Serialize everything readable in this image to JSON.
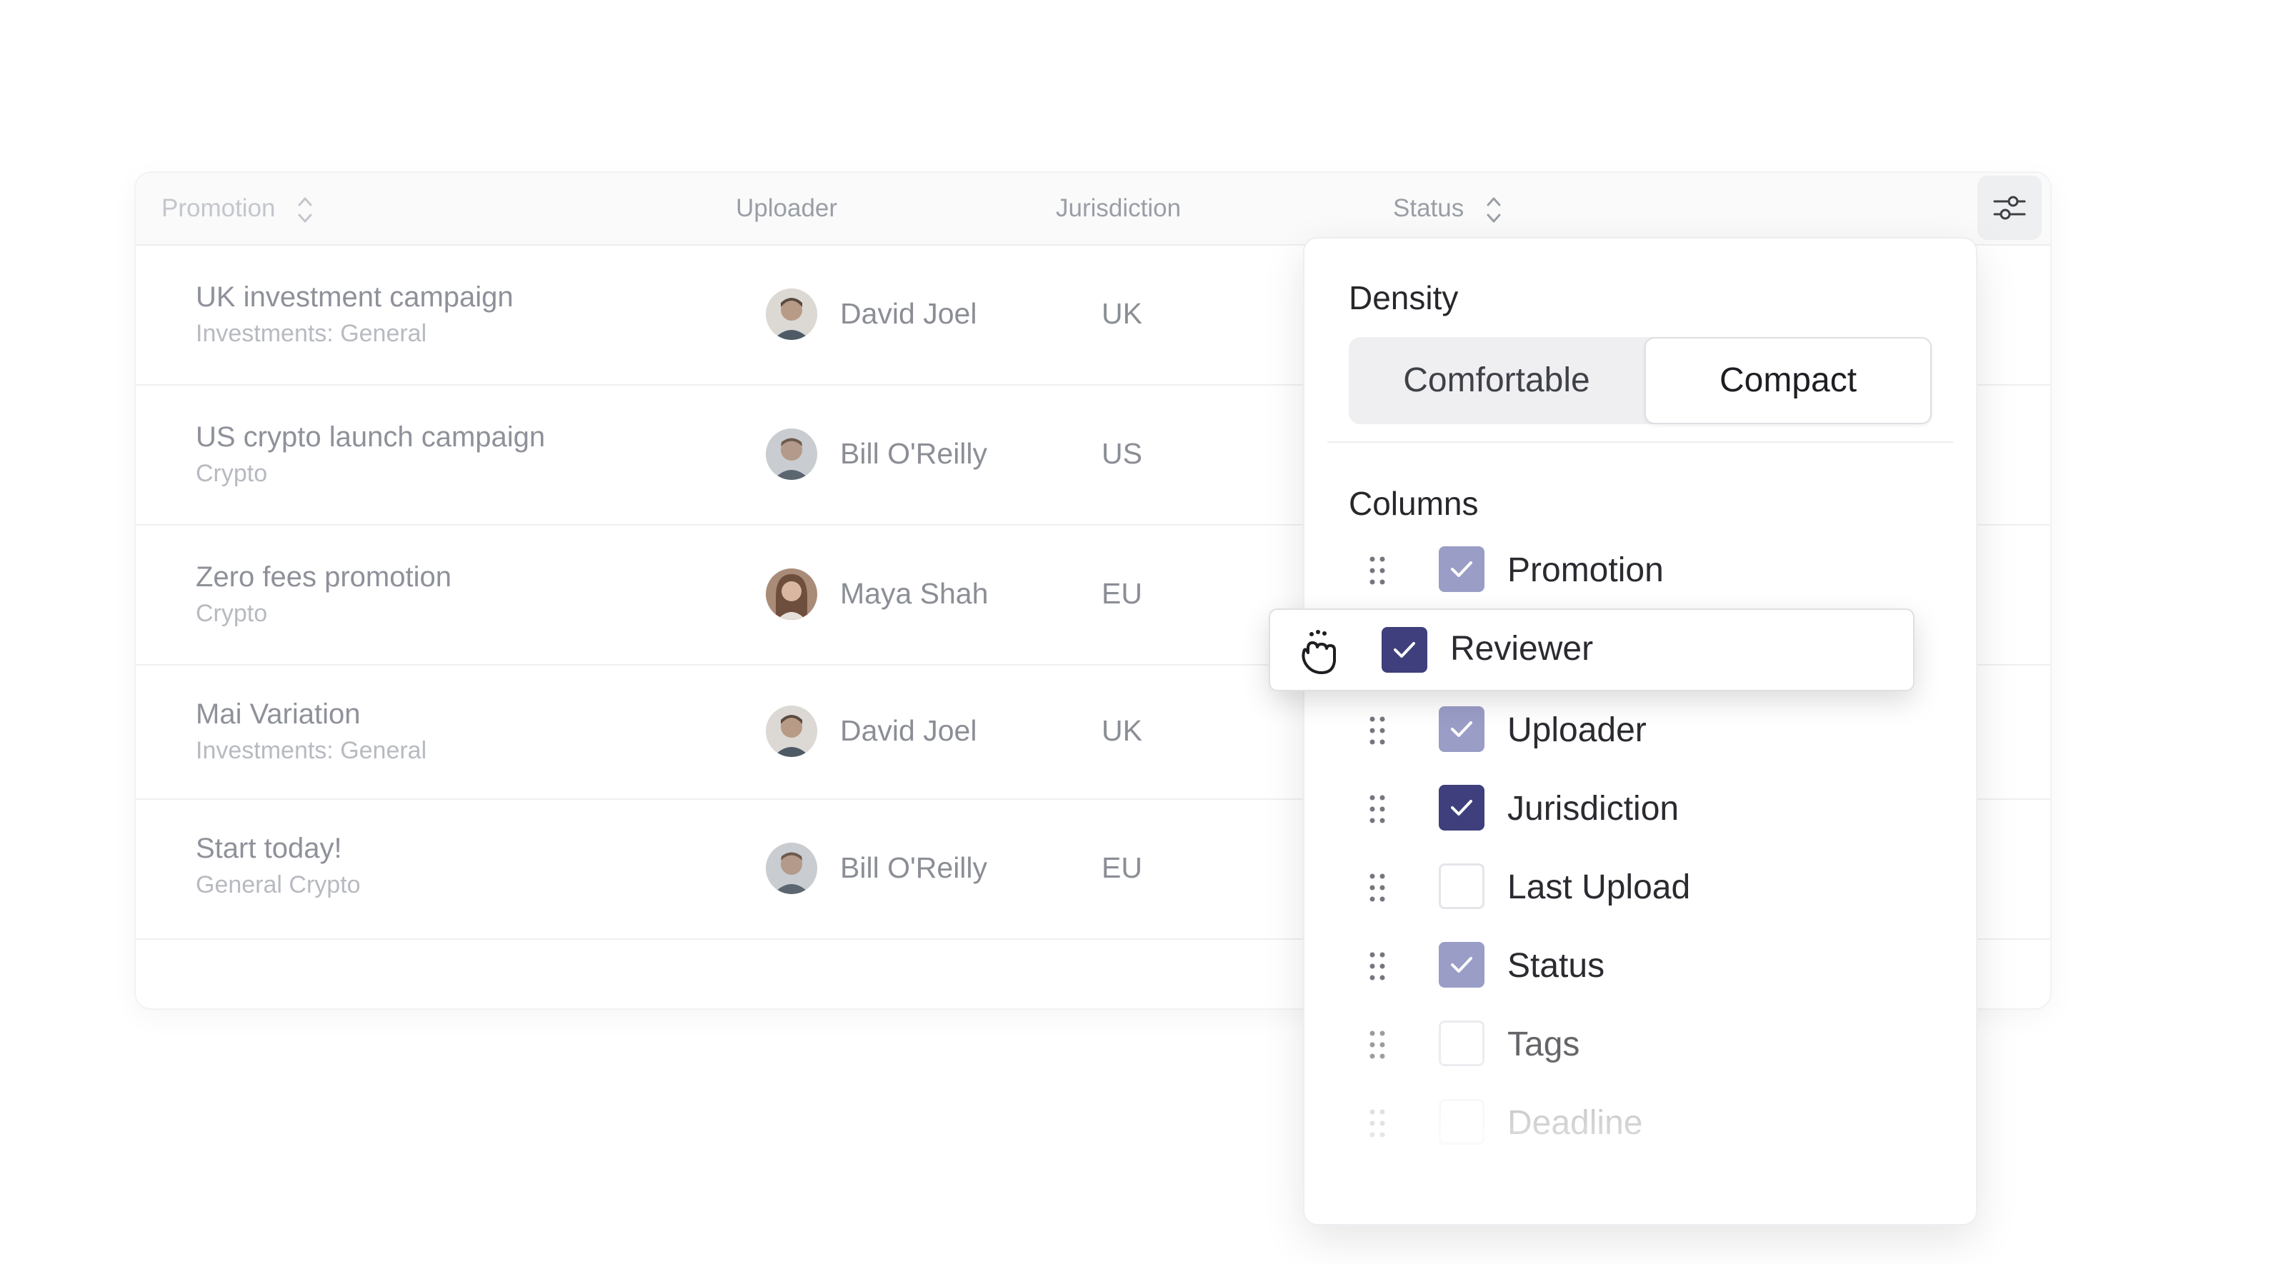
{
  "table": {
    "headers": {
      "promotion": "Promotion",
      "uploader": "Uploader",
      "jurisdiction": "Jurisdiction",
      "status": "Status"
    },
    "rows": [
      {
        "title": "UK investment campaign",
        "subtitle": "Investments: General",
        "uploader": "David Joel",
        "jurisdiction": "UK"
      },
      {
        "title": "US crypto launch campaign",
        "subtitle": "Crypto",
        "uploader": "Bill O'Reilly",
        "jurisdiction": "US"
      },
      {
        "title": "Zero fees promotion",
        "subtitle": "Crypto",
        "uploader": "Maya Shah",
        "jurisdiction": "EU"
      },
      {
        "title": "Mai Variation",
        "subtitle": "Investments: General",
        "uploader": "David Joel",
        "jurisdiction": "UK"
      },
      {
        "title": "Start today!",
        "subtitle": "General Crypto",
        "uploader": "Bill O'Reilly",
        "jurisdiction": "EU"
      }
    ]
  },
  "panel": {
    "density_label": "Density",
    "density_options": [
      "Comfortable",
      "Compact"
    ],
    "density_selected": "Compact",
    "columns_label": "Columns",
    "columns": [
      {
        "label": "Promotion",
        "checked": true
      },
      {
        "label": "Uploader",
        "checked": true
      },
      {
        "label": "Jurisdiction",
        "checked": true
      },
      {
        "label": "Last Upload",
        "checked": false
      },
      {
        "label": "Status",
        "checked": true
      },
      {
        "label": "Tags",
        "checked": false
      },
      {
        "label": "Deadline",
        "checked": false
      }
    ],
    "dragging": {
      "label": "Reviewer",
      "checked": true
    }
  },
  "icons": {
    "settings": "sliders-icon",
    "sort": "sort-icon",
    "grip": "drag-handle-icon",
    "check": "check-icon",
    "cursor": "grab-hand-icon"
  },
  "colors": {
    "checkbox_dark": "#3e3f7c",
    "checkbox_light": "#9a9dc6"
  }
}
